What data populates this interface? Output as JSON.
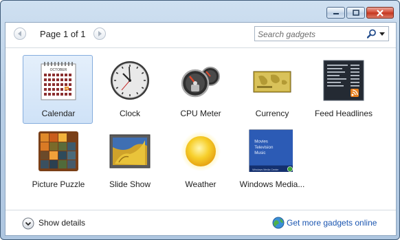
{
  "window": {
    "buttons": {
      "minimize": "minimize-icon",
      "maximize": "maximize-icon",
      "close": "close-icon"
    }
  },
  "toolbar": {
    "page_label": "Page 1 of 1",
    "prev_icon": "chevron-left-icon",
    "next_icon": "chevron-right-icon",
    "search_placeholder": "Search gadgets",
    "search_icon": "search-icon",
    "dropdown_icon": "chevron-down-icon"
  },
  "gadgets": [
    {
      "label": "Calendar",
      "icon": "calendar-icon",
      "selected": true,
      "calendar_month": "OCTOBER",
      "calendar_highlight_day": "26"
    },
    {
      "label": "Clock",
      "icon": "clock-icon",
      "selected": false
    },
    {
      "label": "CPU Meter",
      "icon": "cpu-meter-icon",
      "selected": false
    },
    {
      "label": "Currency",
      "icon": "currency-icon",
      "selected": false
    },
    {
      "label": "Feed Headlines",
      "icon": "feed-headlines-icon",
      "selected": false
    },
    {
      "label": "Picture Puzzle",
      "icon": "picture-puzzle-icon",
      "selected": false
    },
    {
      "label": "Slide Show",
      "icon": "slide-show-icon",
      "selected": false
    },
    {
      "label": "Weather",
      "icon": "weather-icon",
      "selected": false
    },
    {
      "label": "Windows Media...",
      "icon": "windows-media-center-icon",
      "selected": false,
      "menu_items": [
        "Movies",
        "Television",
        "Music"
      ],
      "brand_text": "Windows Media Center"
    }
  ],
  "footer": {
    "details_label": "Show details",
    "details_icon": "expand-circle-icon",
    "online_label": "Get more gadgets online",
    "online_icon": "globe-icon"
  },
  "colors": {
    "frame": "#b9cfe6",
    "selection": "#cfe2f7",
    "link": "#1a55b0",
    "close_button": "#d2462f"
  }
}
